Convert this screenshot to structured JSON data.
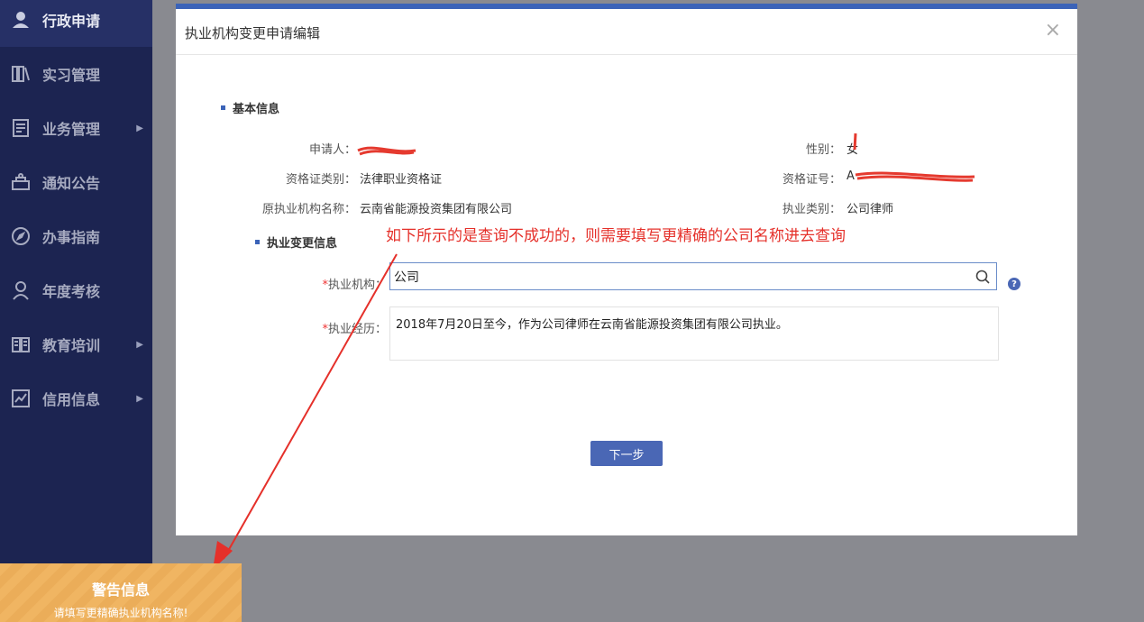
{
  "sidebar": {
    "items": [
      {
        "label": "行政申请",
        "icon": "user-icon"
      },
      {
        "label": "实习管理",
        "icon": "book-stack-icon"
      },
      {
        "label": "业务管理",
        "icon": "document-icon"
      },
      {
        "label": "通知公告",
        "icon": "bell-icon"
      },
      {
        "label": "办事指南",
        "icon": "compass-icon"
      },
      {
        "label": "年度考核",
        "icon": "person-icon"
      },
      {
        "label": "教育培训",
        "icon": "open-book-icon"
      },
      {
        "label": "信用信息",
        "icon": "chart-icon"
      }
    ]
  },
  "modal": {
    "title": "执业机构变更申请编辑",
    "close": "×",
    "basic_section": "基本信息",
    "change_section": "执业变更信息",
    "fields": {
      "applicant_label": "申请人：",
      "gender_label": "性别：",
      "gender_value": "女",
      "cert_type_label": "资格证类别：",
      "cert_type_value": "法律职业资格证",
      "cert_no_label": "资格证号：",
      "cert_no_value": "A",
      "orig_org_label": "原执业机构名称：",
      "orig_org_value": "云南省能源投资集团有限公司",
      "practice_type_label": "执业类别：",
      "practice_type_value": "公司律师",
      "org_label": "执业机构：",
      "org_value": "公司",
      "history_label": "执业经历：",
      "history_value": "2018年7月20日至今，作为公司律师在云南省能源投资集团有限公司执业。",
      "required_mark": "*"
    },
    "help": "?",
    "next_button": "下一步"
  },
  "annotation": "如下所示的是查询不成功的，则需要填写更精确的公司名称进去查询",
  "warning": {
    "title": "警告信息",
    "message": "请填写更精确执业机构名称!"
  },
  "colors": {
    "sidebar_bg": "#1c2451",
    "accent": "#4a67b5",
    "annotation": "#e5302a",
    "warning_bg": "#f0b562"
  }
}
